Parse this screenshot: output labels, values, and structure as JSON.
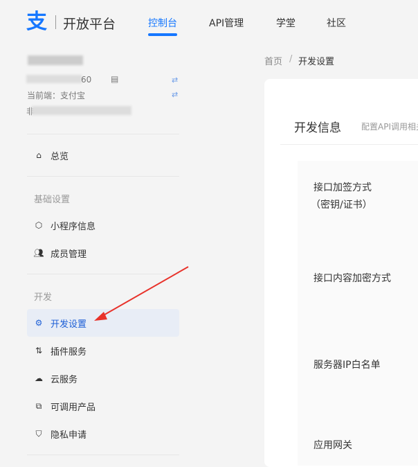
{
  "header": {
    "logo_glyph": "支",
    "brand": "开放平台",
    "nav": [
      {
        "label": "控制台",
        "active": true
      },
      {
        "label": "API管理"
      },
      {
        "label": "学堂"
      },
      {
        "label": "社区"
      }
    ],
    "accent": "#1677ff"
  },
  "account": {
    "id_suffix": "60",
    "current_side": "当前端：支付宝",
    "third_line_prefix": "非"
  },
  "sidebar": {
    "overview": "总览",
    "groups": [
      {
        "title": "基础设置",
        "items": [
          "小程序信息",
          "成员管理"
        ]
      },
      {
        "title": "开发",
        "items": [
          "开发设置",
          "插件服务",
          "云服务",
          "可调用产品",
          "隐私申请"
        ]
      }
    ],
    "active_item": "开发设置"
  },
  "breadcrumb": {
    "home": "首页",
    "separator": "/",
    "current": "开发设置"
  },
  "main": {
    "title": "开发信息",
    "subtitle": "配置API调用相关",
    "rows": [
      "接口加签方式",
      "（密钥/证书）",
      "接口内容加密方式",
      "服务器IP白名单",
      "应用网关"
    ]
  },
  "annotation": {
    "arrow_color": "#e8322a"
  }
}
